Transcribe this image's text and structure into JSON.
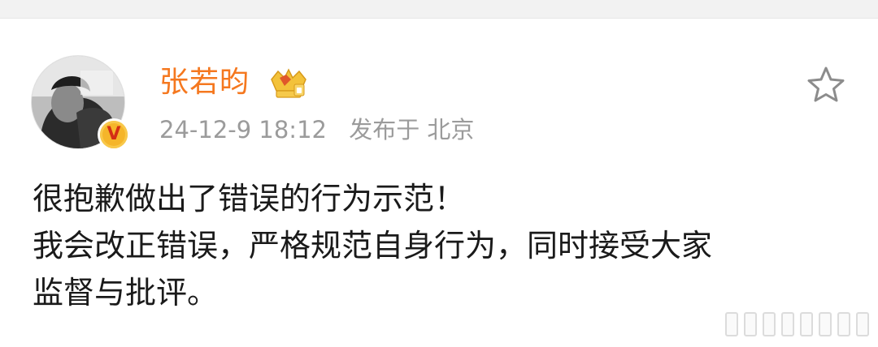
{
  "post": {
    "author": {
      "name": "张若昀",
      "avatar_icon": "avatar-photo",
      "verified_icon": "verified-v-icon",
      "verified_label": "V",
      "vip_icon": "vip-crown-icon"
    },
    "meta": {
      "date": "24-12-9 18:12",
      "source": "发布于 北京"
    },
    "favorite_icon": "star-outline-icon",
    "content_lines": [
      "很抱歉做出了错误的行为示范！",
      "我会改正错误，严格规范自身行为，同时接受大家",
      "监督与批评。"
    ]
  },
  "colors": {
    "username": "#f5781f",
    "meta_text": "#9b9b9b",
    "body_text": "#1a1a1a",
    "verified_badge": "#f5b52a",
    "verified_letter": "#d42e14"
  }
}
